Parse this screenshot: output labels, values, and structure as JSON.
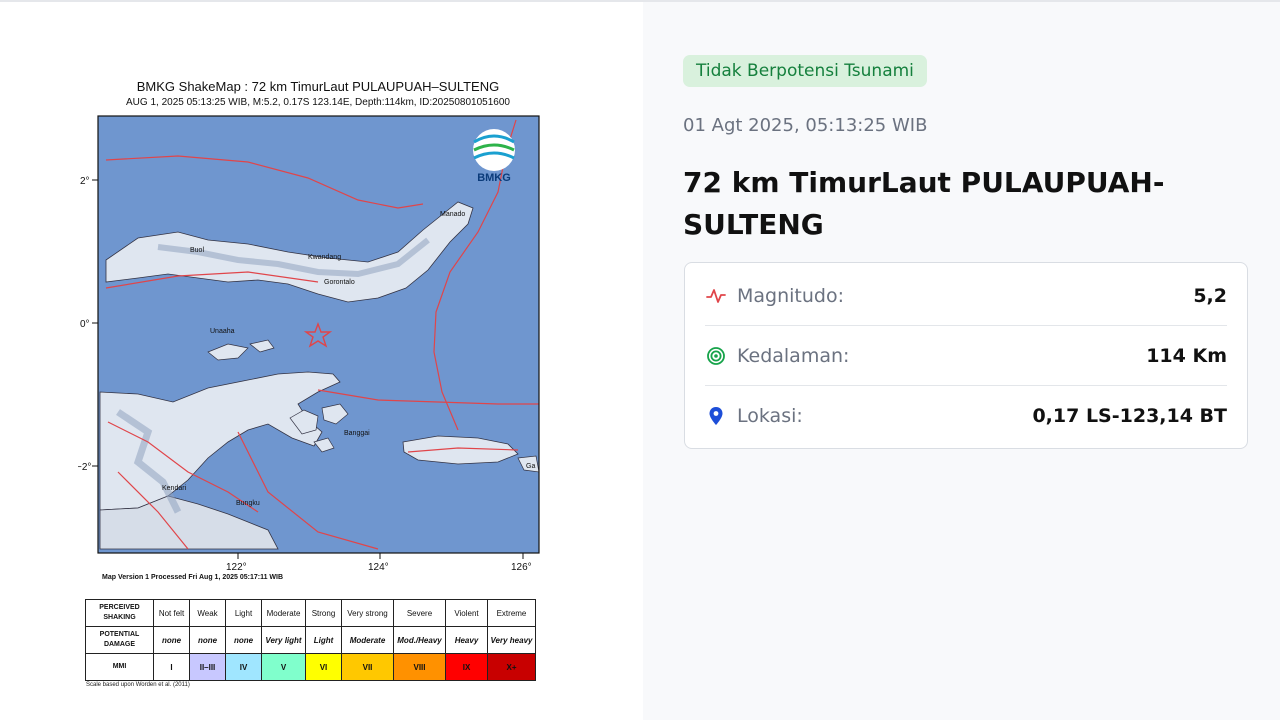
{
  "shakemap": {
    "title": "BMKG ShakeMap : 72 km TimurLaut PULAUPUAH–SULTENG",
    "subtitle": "AUG 1, 2025 05:13:25 WIB, M:5.2, 0.17S 123.14E, Depth:114km, ID:20250801051600",
    "logo_text": "BMKG",
    "lat_ticks": [
      "2°",
      "0°",
      "−2°"
    ],
    "lon_ticks": [
      "122°",
      "124°",
      "126°"
    ],
    "places": [
      "Buol",
      "Kwandang",
      "Gorontalo",
      "Unaaha",
      "Banggai",
      "Bungku",
      "Manado",
      "Kendari",
      "Ga"
    ],
    "version_text": "Map Version 1 Processed Fri Aug  1, 2025 05:17:11 WIB",
    "scale_note": "Scale based upon Worden et al. (2011)",
    "legend": {
      "shaking_header": "PERCEIVED SHAKING",
      "damage_header": "POTENTIAL DAMAGE",
      "mmi_header": "MMI",
      "shaking": [
        "Not felt",
        "Weak",
        "Light",
        "Moderate",
        "Strong",
        "Very strong",
        "Severe",
        "Violent",
        "Extreme"
      ],
      "damage": [
        "none",
        "none",
        "none",
        "Very light",
        "Light",
        "Moderate",
        "Mod./Heavy",
        "Heavy",
        "Very heavy"
      ],
      "mmi": [
        "I",
        "II–III",
        "IV",
        "V",
        "VI",
        "VII",
        "VIII",
        "IX",
        "X+"
      ],
      "mmi_colors": [
        "#ffffff",
        "#c8c8ff",
        "#a0e6ff",
        "#80ffcc",
        "#ffff00",
        "#ffc800",
        "#ff9100",
        "#ff0000",
        "#c80000"
      ]
    }
  },
  "info": {
    "tsunami_badge": "Tidak Berpotensi Tsunami",
    "datetime": "01 Agt 2025, 05:13:25 WIB",
    "location_title": "72 km TimurLaut PULAUPUAH-SULTENG",
    "rows": [
      {
        "icon": "activity-pulse-icon",
        "label": "Magnitudo:",
        "value": "5,2"
      },
      {
        "icon": "depth-target-icon",
        "label": "Kedalaman:",
        "value": "114 Km"
      },
      {
        "icon": "map-pin-icon",
        "label": "Lokasi:",
        "value": "0,17 LS-123,14 BT"
      }
    ]
  },
  "colors": {
    "badge_bg": "#d9f1dd",
    "badge_text": "#15803d",
    "sea": "#6f96cf",
    "fault": "#e0454a",
    "pin": "#1d4ed8",
    "pulse": "#e0454a",
    "target": "#16a34a"
  }
}
